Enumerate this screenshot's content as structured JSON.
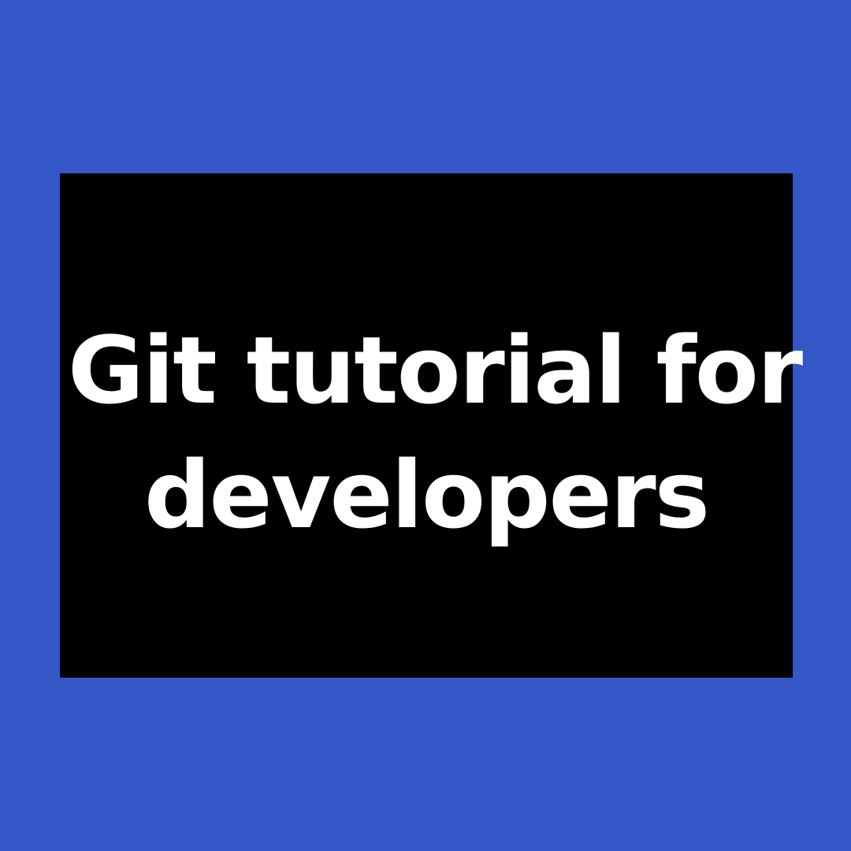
{
  "colors": {
    "background": "#3357C6",
    "card": "#000000",
    "text": "#FFFFFF"
  },
  "title": {
    "line1": "Git tutorial for",
    "line2": "developers"
  }
}
